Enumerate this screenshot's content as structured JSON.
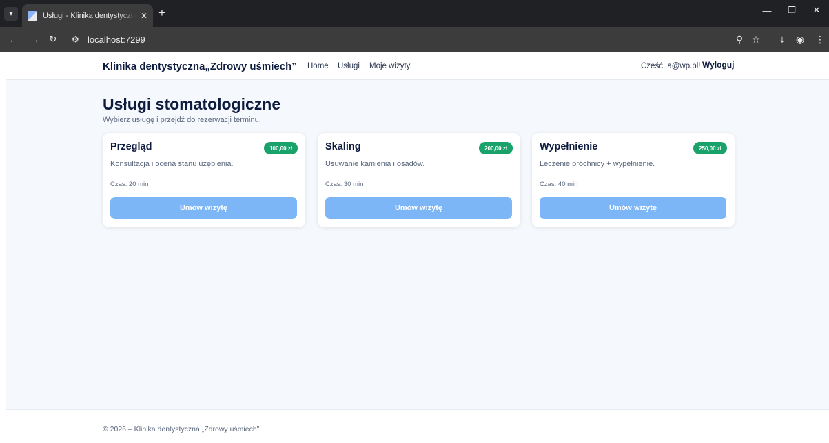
{
  "browser": {
    "tab_title": "Usługi - Klinika dentystyczna „Zdrowy uśmiech”",
    "tab_close": "✕",
    "new_tab": "+",
    "url": "localhost:7299"
  },
  "navbar": {
    "brand": "Klinika dentystyczna„Zdrowy uśmiech”",
    "links": [
      "Home",
      "Usługi",
      "Moje wizyty"
    ],
    "greeting": "Cześć, a@wp.pl!",
    "logout": "Wyloguj"
  },
  "main": {
    "title": "Usługi stomatologiczne",
    "subtitle": "Wybierz usługę i przejdź do rezerwacji terminu."
  },
  "services": [
    {
      "name": "Przegląd",
      "price": "100,00 zł",
      "description": "Konsultacja i ocena stanu uzębienia.",
      "duration": "Czas: 20 min",
      "button": "Umów wizytę"
    },
    {
      "name": "Skaling",
      "price": "200,00 zł",
      "description": "Usuwanie kamienia i osadów.",
      "duration": "Czas: 30 min",
      "button": "Umów wizytę"
    },
    {
      "name": "Wypełnienie",
      "price": "250,00 zł",
      "description": "Leczenie próchnicy + wypełnienie.",
      "duration": "Czas: 40 min",
      "button": "Umów wizytę"
    }
  ],
  "footer": {
    "text": "© 2026 – Klinika dentystyczna „Zdrowy uśmiech”"
  },
  "colors": {
    "brand_dark": "#0d1b3e",
    "price_badge": "#19a36b",
    "primary_button": "#7cb6f6",
    "page_background": "#f5f8fc"
  }
}
